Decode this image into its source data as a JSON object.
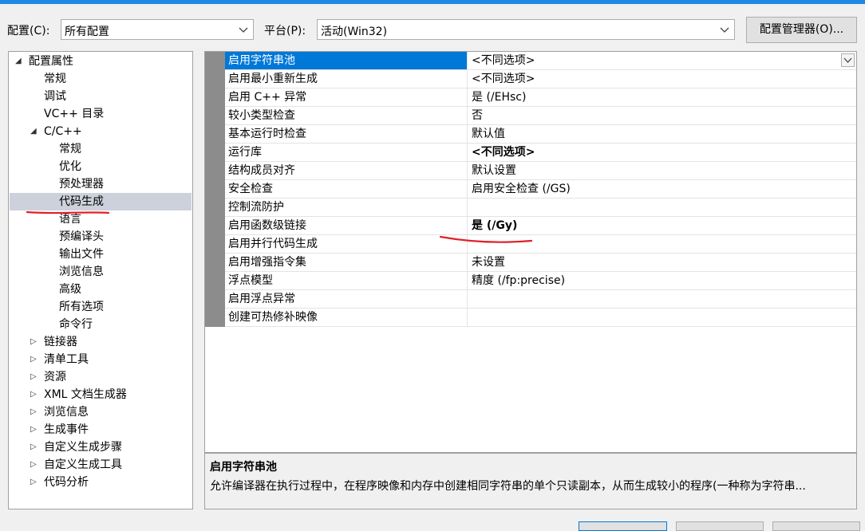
{
  "config": {
    "label": "配置(C):",
    "value": "所有配置"
  },
  "platform": {
    "label": "平台(P):",
    "value": "活动(Win32)"
  },
  "manager_button": "配置管理器(O)...",
  "tree": [
    {
      "label": "配置属性",
      "level": 0,
      "arrow": "expanded"
    },
    {
      "label": "常规",
      "level": 1
    },
    {
      "label": "调试",
      "level": 1
    },
    {
      "label": "VC++ 目录",
      "level": 1
    },
    {
      "label": "C/C++",
      "level": 1,
      "arrow": "expanded"
    },
    {
      "label": "常规",
      "level": 2
    },
    {
      "label": "优化",
      "level": 2
    },
    {
      "label": "预处理器",
      "level": 2
    },
    {
      "label": "代码生成",
      "level": 2,
      "selected": true
    },
    {
      "label": "语言",
      "level": 2
    },
    {
      "label": "预编译头",
      "level": 2
    },
    {
      "label": "输出文件",
      "level": 2
    },
    {
      "label": "浏览信息",
      "level": 2
    },
    {
      "label": "高级",
      "level": 2
    },
    {
      "label": "所有选项",
      "level": 2
    },
    {
      "label": "命令行",
      "level": 2
    },
    {
      "label": "链接器",
      "level": 1,
      "arrow": "collapsed"
    },
    {
      "label": "清单工具",
      "level": 1,
      "arrow": "collapsed"
    },
    {
      "label": "资源",
      "level": 1,
      "arrow": "collapsed"
    },
    {
      "label": "XML 文档生成器",
      "level": 1,
      "arrow": "collapsed"
    },
    {
      "label": "浏览信息",
      "level": 1,
      "arrow": "collapsed"
    },
    {
      "label": "生成事件",
      "level": 1,
      "arrow": "collapsed"
    },
    {
      "label": "自定义生成步骤",
      "level": 1,
      "arrow": "collapsed"
    },
    {
      "label": "自定义生成工具",
      "level": 1,
      "arrow": "collapsed"
    },
    {
      "label": "代码分析",
      "level": 1,
      "arrow": "collapsed"
    }
  ],
  "properties": [
    {
      "name": "启用字符串池",
      "value": "<不同选项>",
      "selected": true
    },
    {
      "name": "启用最小重新生成",
      "value": "<不同选项>"
    },
    {
      "name": "启用 C++ 异常",
      "value": "是 (/EHsc)"
    },
    {
      "name": "较小类型检查",
      "value": "否"
    },
    {
      "name": "基本运行时检查",
      "value": "默认值"
    },
    {
      "name": "运行库",
      "value": "<不同选项>",
      "bold": true
    },
    {
      "name": "结构成员对齐",
      "value": "默认设置"
    },
    {
      "name": "安全检查",
      "value": "启用安全检查 (/GS)"
    },
    {
      "name": "控制流防护",
      "value": ""
    },
    {
      "name": "启用函数级链接",
      "value": "是 (/Gy)",
      "bold": true
    },
    {
      "name": "启用并行代码生成",
      "value": ""
    },
    {
      "name": "启用增强指令集",
      "value": "未设置"
    },
    {
      "name": "浮点模型",
      "value": "精度 (/fp:precise)"
    },
    {
      "name": "启用浮点异常",
      "value": ""
    },
    {
      "name": "创建可热修补映像",
      "value": ""
    }
  ],
  "description": {
    "title": "启用字符串池",
    "body": "允许编译器在执行过程中，在程序映像和内存中创建相同字符串的单个只读副本，从而生成较小的程序(一种称为字符串..."
  },
  "colors": {
    "accent": "#1e88e5",
    "selection": "#0078d7",
    "annotation": "#e0202a"
  }
}
